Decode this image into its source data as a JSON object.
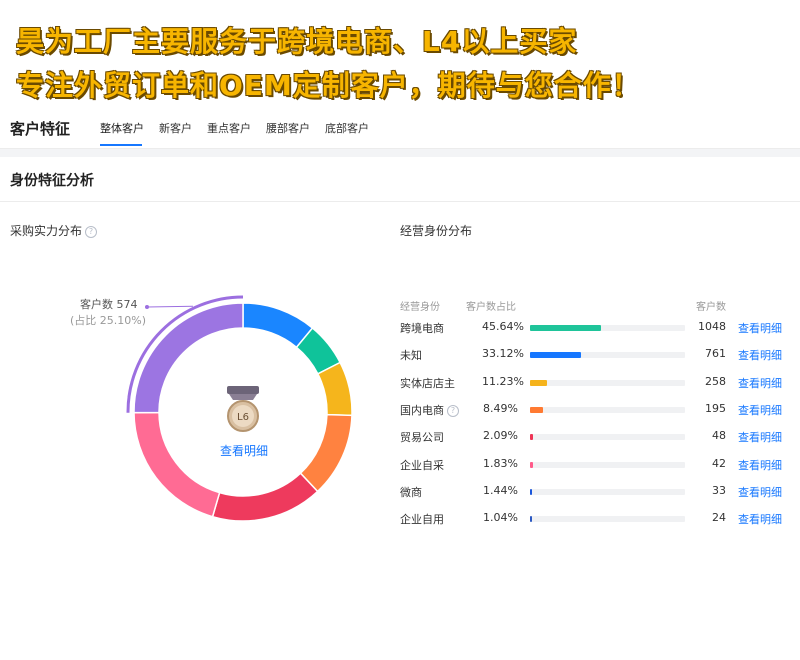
{
  "banner": {
    "line1": "昊为工厂主要服务于跨境电商、L4以上买家",
    "line2": "专注外贸订单和OEM定制客户，期待与您合作！"
  },
  "tabs": {
    "title": "客户特征",
    "items": [
      "整体客户",
      "新客户",
      "重点客户",
      "腰部客户",
      "底部客户"
    ],
    "active": 0
  },
  "section": {
    "title": "身份特征分析"
  },
  "purchase_power": {
    "title": "采购实力分布",
    "help_icon": "question-circle-icon",
    "callout_count": "客户数 574",
    "callout_ratio": "(占比 25.10%)",
    "badge_level": "L6",
    "center_link": "查看明细",
    "highlight_color": "#9c6fe0"
  },
  "identity": {
    "title": "经营身份分布",
    "headers": {
      "identity": "经营身份",
      "ratio": "客户数占比",
      "count": "客户数"
    },
    "link_label": "查看明细",
    "rows": [
      {
        "name": "跨境电商",
        "pct": "45.64%",
        "value": 45.64,
        "count": "1048",
        "color": "#1fc49a",
        "help": false
      },
      {
        "name": "未知",
        "pct": "33.12%",
        "value": 33.12,
        "count": "761",
        "color": "#1677ff",
        "help": false
      },
      {
        "name": "实体店店主",
        "pct": "11.23%",
        "value": 11.23,
        "count": "258",
        "color": "#f5b31c",
        "help": false
      },
      {
        "name": "国内电商",
        "pct": "8.49%",
        "value": 8.49,
        "count": "195",
        "color": "#ff7a32",
        "help": true
      },
      {
        "name": "贸易公司",
        "pct": "2.09%",
        "value": 2.09,
        "count": "48",
        "color": "#ee3455",
        "help": false
      },
      {
        "name": "企业自采",
        "pct": "1.83%",
        "value": 1.83,
        "count": "42",
        "color": "#ff5b8a",
        "help": false
      },
      {
        "name": "微商",
        "pct": "1.44%",
        "value": 1.44,
        "count": "33",
        "color": "#1a56db",
        "help": false
      },
      {
        "name": "企业自用",
        "pct": "1.04%",
        "value": 1.04,
        "count": "24",
        "color": "#2b59c3",
        "help": false
      }
    ]
  },
  "chart_data": {
    "type": "pie",
    "donut": true,
    "highlight_index": 6,
    "slices": [
      {
        "value": 11.0,
        "color": "#1a86ff"
      },
      {
        "value": 6.5,
        "color": "#0fc39a"
      },
      {
        "value": 8.0,
        "color": "#f5b51c"
      },
      {
        "value": 12.5,
        "color": "#ff8240"
      },
      {
        "value": 16.5,
        "color": "#ee3a5d"
      },
      {
        "value": 20.4,
        "color": "#ff6b94"
      },
      {
        "value": 25.1,
        "color": "#9c75e2"
      }
    ]
  }
}
